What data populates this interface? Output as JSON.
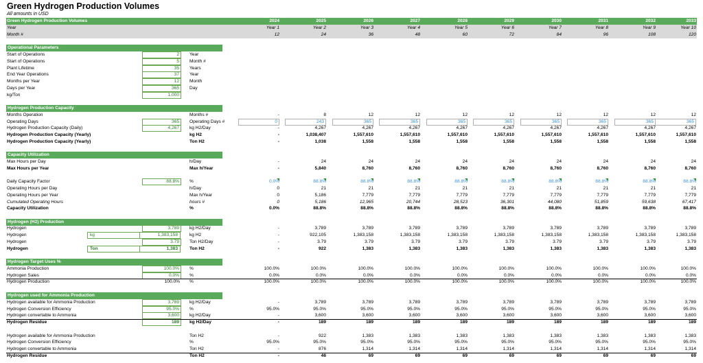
{
  "title": "Green Hydrogen Production Volumes",
  "subtitle": "All amounts in USD",
  "header": {
    "section_label": "Green Hydrogen Production Volumes",
    "years": [
      "2024",
      "2025",
      "2026",
      "2027",
      "2028",
      "2029",
      "2030",
      "2031",
      "2032",
      "2033"
    ],
    "year_row_label": "Year",
    "year_labels": [
      "Year 1",
      "Year 2",
      "Year 3",
      "Year 4",
      "Year 5",
      "Year 6",
      "Year 7",
      "Year 8",
      "Year 9",
      "Year 10"
    ],
    "month_row_label": "Month #",
    "months": [
      "12",
      "24",
      "36",
      "48",
      "60",
      "72",
      "84",
      "96",
      "108",
      "120"
    ]
  },
  "operational": {
    "title": "Operational Parameters",
    "rows": [
      {
        "label": "Start of Operations",
        "value": "2",
        "unit": "Year"
      },
      {
        "label": "Start of Operations",
        "value": "5",
        "unit": "Month #"
      },
      {
        "label": "Plant Lifetime",
        "value": "35",
        "unit": "Years"
      },
      {
        "label": "End Year Operations",
        "value": "37",
        "unit": "Year"
      },
      {
        "label": "Months per Year",
        "value": "12",
        "unit": "Month"
      },
      {
        "label": "Days per Year",
        "value": "365",
        "unit": "Day"
      },
      {
        "label": "kg/Ton",
        "value": "1,000",
        "unit": ""
      }
    ]
  },
  "capacity": {
    "title": "Hydrogen Production Capacity",
    "rows": [
      {
        "label": "Months Operation",
        "value": "",
        "unit": "Months #",
        "vals": [
          "-",
          "8",
          "12",
          "12",
          "12",
          "12",
          "12",
          "12",
          "12",
          "12"
        ]
      },
      {
        "label": "Operating Days",
        "value": "365",
        "unit": "Operating Days #",
        "vals": [
          "0",
          "243",
          "365",
          "365",
          "365",
          "365",
          "365",
          "365",
          "365",
          "365"
        ]
      },
      {
        "label": "Hydrogen Production Capacity (Daily)",
        "value": "4,267",
        "unit": "kg H2/Day",
        "vals": [
          "-",
          "4,267",
          "4,267",
          "4,267",
          "4,267",
          "4,267",
          "4,267",
          "4,267",
          "4,267",
          "4,267"
        ]
      },
      {
        "label": "Hydrogen Production Capacity (Yearly)",
        "value": "",
        "unit": "kg H2",
        "vals": [
          "-",
          "1,038,407",
          "1,557,610",
          "1,557,610",
          "1,557,610",
          "1,557,610",
          "1,557,610",
          "1,557,610",
          "1,557,610",
          "1,557,610"
        ]
      },
      {
        "label": "Hydrogen Production Capacity (Yearly)",
        "value": "",
        "unit": "Ton H2",
        "vals": [
          "-",
          "1,038",
          "1,558",
          "1,558",
          "1,558",
          "1,558",
          "1,558",
          "1,558",
          "1,558",
          "1,558"
        ]
      }
    ]
  },
  "utilization": {
    "title": "Capacity Utilization",
    "rows": [
      {
        "label": "Max Hours per Day",
        "value": "",
        "unit": "h/Day",
        "vals": [
          "-",
          "24",
          "24",
          "24",
          "24",
          "24",
          "24",
          "24",
          "24",
          "24"
        ]
      },
      {
        "label": "Max Hours per Year",
        "value": "",
        "unit": "Max h/Year",
        "vals": [
          "-",
          "5,840",
          "8,760",
          "8,760",
          "8,760",
          "8,760",
          "8,760",
          "8,760",
          "8,760",
          "8,760"
        ]
      },
      {
        "label": "Daily Capacity Factor",
        "value": "88.8%",
        "unit": "%",
        "vals": [
          "0.0%",
          "88.8%",
          "88.8%",
          "88.8%",
          "88.8%",
          "88.8%",
          "88.8%",
          "88.8%",
          "88.8%",
          "88.8%"
        ]
      },
      {
        "label": "Operating Hours per Day",
        "value": "",
        "unit": "h/Day",
        "vals": [
          "0",
          "21",
          "21",
          "21",
          "21",
          "21",
          "21",
          "21",
          "21",
          "21"
        ]
      },
      {
        "label": "Operating Hours per Year",
        "value": "",
        "unit": "Max h/Year",
        "vals": [
          "0",
          "5,186",
          "7,779",
          "7,779",
          "7,779",
          "7,779",
          "7,779",
          "7,779",
          "7,779",
          "7,779"
        ]
      },
      {
        "label": "Cumulated Operating Hours",
        "value": "",
        "unit": "hours #",
        "vals": [
          "0",
          "5,186",
          "12,965",
          "20,744",
          "28,523",
          "36,301",
          "44,080",
          "51,859",
          "59,638",
          "67,417"
        ]
      },
      {
        "label": "Capacity Utilization",
        "value": "",
        "unit": "%",
        "vals": [
          "0.0%",
          "88.8%",
          "88.8%",
          "88.8%",
          "88.8%",
          "88.8%",
          "88.8%",
          "88.8%",
          "88.8%",
          "88.8%"
        ]
      }
    ]
  },
  "production": {
    "title": "Hydrogen (H2) Production",
    "rows": [
      {
        "label": "Hydrogen",
        "tag": "",
        "value": "3,789",
        "unit": "kg H2/Day",
        "vals": [
          "-",
          "3,789",
          "3,789",
          "3,789",
          "3,789",
          "3,789",
          "3,789",
          "3,789",
          "3,789",
          "3,789"
        ]
      },
      {
        "label": "Hydrogen",
        "tag": "kg",
        "value": "1,383,158",
        "unit": "kg H2",
        "vals": [
          "-",
          "922,105",
          "1,383,158",
          "1,383,158",
          "1,383,158",
          "1,383,158",
          "1,383,158",
          "1,383,158",
          "1,383,158",
          "1,383,158"
        ]
      },
      {
        "label": "Hydrogen",
        "tag": "",
        "value": "3.79",
        "unit": "Ton H2/Day",
        "vals": [
          "-",
          "3.79",
          "3.79",
          "3.79",
          "3.79",
          "3.79",
          "3.79",
          "3.79",
          "3.79",
          "3.79"
        ]
      },
      {
        "label": "Hydrogen",
        "tag": "Ton",
        "value": "1,383",
        "unit": "Ton H2",
        "vals": [
          "-",
          "922",
          "1,383",
          "1,383",
          "1,383",
          "1,383",
          "1,383",
          "1,383",
          "1,383",
          "1,383"
        ]
      }
    ]
  },
  "target": {
    "title": "Hydrogen Target Uses %",
    "rows": [
      {
        "label": "Ammonia Production",
        "value": "100.0%",
        "unit": "%",
        "vals": [
          "100.0%",
          "100.0%",
          "100.0%",
          "100.0%",
          "100.0%",
          "100.0%",
          "100.0%",
          "100.0%",
          "100.0%",
          "100.0%"
        ]
      },
      {
        "label": "Hydrogen Sales",
        "value": "0.0%",
        "unit": "%",
        "vals": [
          "0.0%",
          "0.0%",
          "0.0%",
          "0.0%",
          "0.0%",
          "0.0%",
          "0.0%",
          "0.0%",
          "0.0%",
          "0.0%"
        ]
      },
      {
        "label": "Hydrogen Production",
        "value": "100.0%",
        "unit": "%",
        "vals": [
          "100.0%",
          "100.0%",
          "100.0%",
          "100.0%",
          "100.0%",
          "100.0%",
          "100.0%",
          "100.0%",
          "100.0%",
          "100.0%"
        ]
      }
    ]
  },
  "ammonia": {
    "title": "Hydrogen used for Ammonia Production",
    "rows": [
      {
        "label": "Hydrogen available for Ammonia Production",
        "value": "3,789",
        "unit": "kg H2/Day",
        "vals": [
          "-",
          "3,789",
          "3,789",
          "3,789",
          "3,789",
          "3,789",
          "3,789",
          "3,789",
          "3,789",
          "3,789"
        ]
      },
      {
        "label": "Hydrogen Conversion Efficiency",
        "value": "95.0%",
        "unit": "%",
        "vals": [
          "95.0%",
          "95.0%",
          "95.0%",
          "95.0%",
          "95.0%",
          "95.0%",
          "95.0%",
          "95.0%",
          "95.0%",
          "95.0%"
        ]
      },
      {
        "label": "Hydrogen convertable to Ammonia",
        "value": "3,600",
        "unit": "kg H2/Day",
        "vals": [
          "-",
          "3,600",
          "3,600",
          "3,600",
          "3,600",
          "3,600",
          "3,600",
          "3,600",
          "3,600",
          "3,600"
        ]
      },
      {
        "label": "Hydrogen Residue",
        "value": "189",
        "unit": "kg H2/Day",
        "vals": [
          "-",
          "189",
          "189",
          "189",
          "189",
          "189",
          "189",
          "189",
          "189",
          "189"
        ]
      },
      {
        "label": "Hydrogen available for Ammonia Production",
        "value": "",
        "unit": "Ton H2",
        "vals": [
          "-",
          "922",
          "1,383",
          "1,383",
          "1,383",
          "1,383",
          "1,383",
          "1,383",
          "1,383",
          "1,383"
        ]
      },
      {
        "label": "Hydrogen Conversion Efficiency",
        "value": "",
        "unit": "%",
        "vals": [
          "95.0%",
          "95.0%",
          "95.0%",
          "95.0%",
          "95.0%",
          "95.0%",
          "95.0%",
          "95.0%",
          "95.0%",
          "95.0%"
        ]
      },
      {
        "label": "Hydrogen convertable to Ammonia",
        "value": "",
        "unit": "Ton H2",
        "vals": [
          "-",
          "876",
          "1,314",
          "1,314",
          "1,314",
          "1,314",
          "1,314",
          "1,314",
          "1,314",
          "1,314"
        ]
      },
      {
        "label": "Hydrogen Residue",
        "value": "",
        "unit": "Ton H2",
        "vals": [
          "-",
          "46",
          "69",
          "69",
          "69",
          "69",
          "69",
          "69",
          "69",
          "69"
        ]
      }
    ]
  },
  "colors": {
    "accent": "#5aaa5c",
    "header_gray": "#d9d9d9",
    "input_text": "#2a7a2a",
    "link_blue": "#3a8fd6"
  }
}
